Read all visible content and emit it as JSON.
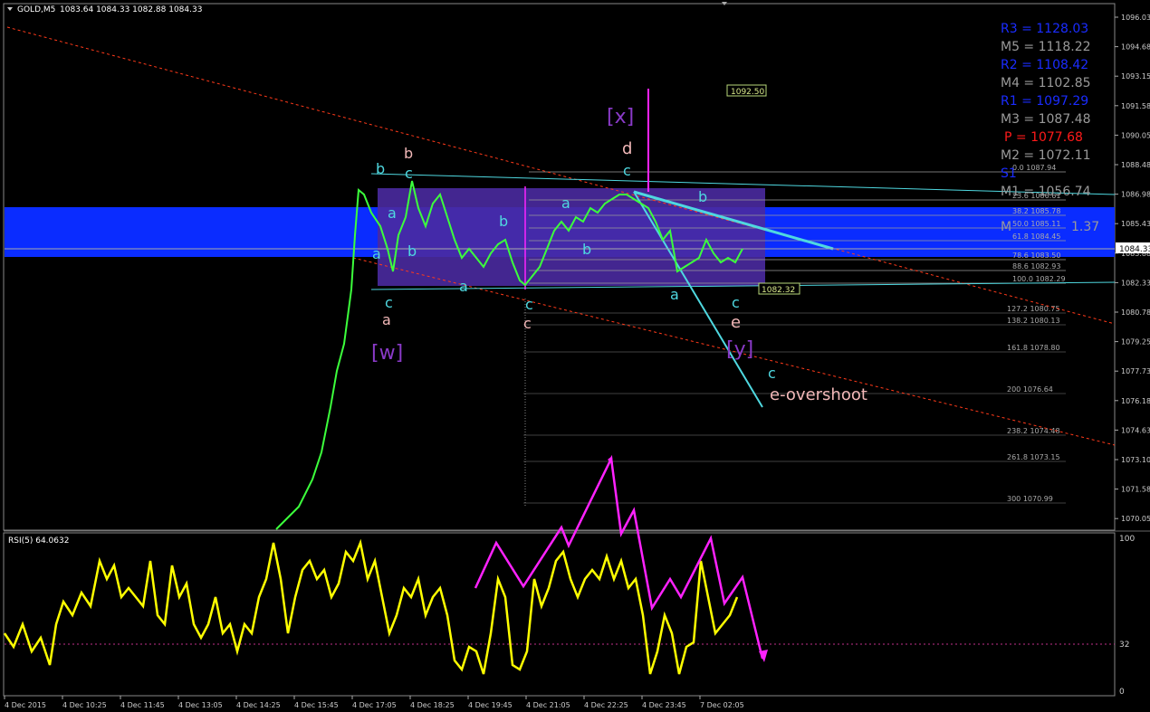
{
  "header": {
    "symbol": "GOLD,M5",
    "ohlc": "1083.64 1084.33 1082.88 1084.33"
  },
  "indicator": {
    "label": "RSI(5) 64.0632",
    "levels": [
      "100",
      "32",
      "0"
    ]
  },
  "price_axis": [
    "1096.03",
    "1094.68",
    "1093.15",
    "1091.58",
    "1090.05",
    "1088.48",
    "1086.98",
    "1085.43",
    "1083.88",
    "1082.33",
    "1080.78",
    "1079.25",
    "1077.73",
    "1076.18",
    "1074.63",
    "1073.10",
    "1071.58",
    "1070.05"
  ],
  "current_price": "1084.33",
  "time_axis": [
    "4 Dec 2015",
    "4 Dec 10:25",
    "4 Dec 11:45",
    "4 Dec 13:05",
    "4 Dec 14:25",
    "4 Dec 15:45",
    "4 Dec 17:05",
    "4 Dec 18:25",
    "4 Dec 19:45",
    "4 Dec 21:05",
    "4 Dec 22:25",
    "4 Dec 23:45",
    "7 Dec 02:05"
  ],
  "pivots": [
    {
      "label": "R3 = 1128.03",
      "color": "#1a2cff"
    },
    {
      "label": "M5 = 1118.22",
      "color": "#9a9a9a"
    },
    {
      "label": "R2 = 1108.42",
      "color": "#1a2cff"
    },
    {
      "label": "M4 = 1102.85",
      "color": "#9a9a9a"
    },
    {
      "label": "R1 = 1097.29",
      "color": "#1a2cff"
    },
    {
      "label": "M3 = 1087.48",
      "color": "#9a9a9a"
    },
    {
      "label": "P  = 1077.68",
      "color": "#ff1a1a"
    },
    {
      "label": "M2 = 1072.11",
      "color": "#9a9a9a"
    },
    {
      "label": "S1",
      "color": "#1a2cff"
    },
    {
      "label": "M1 = 1056.74",
      "color": "#9a9a9a"
    },
    {
      "label": "M",
      "color": "#9a9a9a"
    },
    {
      "label": "1.37",
      "color": "#9a9a9a"
    }
  ],
  "fib_levels": [
    "0.0 1087.94",
    "23.6 1086.61",
    "38.2 1085.78",
    "50.0 1085.11",
    "61.8 1084.45",
    "78.6 1083.50",
    "88.6 1082.93",
    "100.0 1082.29",
    "127.2 1080.75",
    "138.2 1080.13",
    "161.8 1078.80",
    "200 1076.64",
    "238.2 1074.48",
    "261.8 1073.15",
    "300 1070.99"
  ],
  "price_boxes": [
    "1092.50",
    "1082.32"
  ],
  "wave_labels": {
    "w": "[w]",
    "x": "[x]",
    "y": "[y]",
    "a": "a",
    "b": "b",
    "c": "c",
    "d": "d",
    "e": "e",
    "overshoot": "e-overshoot"
  },
  "colors": {
    "blue_band": "#0a2cff",
    "rect_fill": "#4a2aa0",
    "magenta": "#ff22ff",
    "cyan": "#4fd8e0",
    "rsi": "#ffff00",
    "candle": "#3cff3c",
    "pink": "#f2b8b8",
    "purple": "#8a3ac8"
  }
}
